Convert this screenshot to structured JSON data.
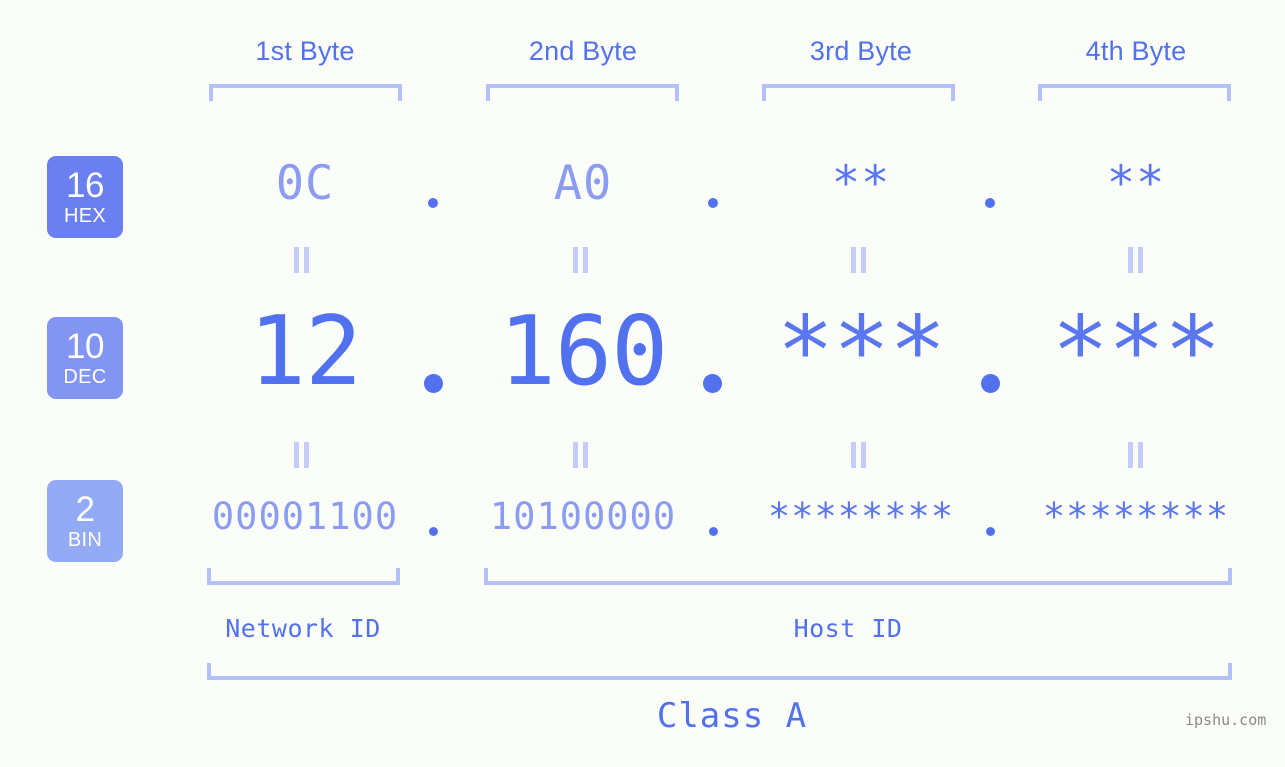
{
  "meta": {
    "watermark": "ipshu.com",
    "background_color": "#fbfdf8",
    "accent_color": "#5271ef",
    "accent_light_color": "#8b9cf2",
    "bracket_color": "#b4c0fa"
  },
  "byte_headers": [
    {
      "label": "1st Byte"
    },
    {
      "label": "2nd Byte"
    },
    {
      "label": "3rd Byte"
    },
    {
      "label": "4th Byte"
    }
  ],
  "radix_badges": [
    {
      "number": "16",
      "name": "HEX",
      "color": "#6a7ff0"
    },
    {
      "number": "10",
      "name": "DEC",
      "color": "#8295f3"
    },
    {
      "number": "2",
      "name": "BIN",
      "color": "#93aaf5"
    }
  ],
  "rows": {
    "hex": {
      "radix": "16",
      "values": [
        "0C",
        "A0",
        "**",
        "**"
      ],
      "separator": "."
    },
    "dec": {
      "radix": "10",
      "values": [
        "12",
        "160",
        "***",
        "***"
      ],
      "separator": "."
    },
    "bin": {
      "radix": "2",
      "values": [
        "00001100",
        "10100000",
        "********",
        "********"
      ],
      "separator": "."
    }
  },
  "equivalence_symbol": "=",
  "sections": [
    {
      "label": "Network ID"
    },
    {
      "label": "Host ID"
    }
  ],
  "address_class": {
    "label": "Class A"
  }
}
